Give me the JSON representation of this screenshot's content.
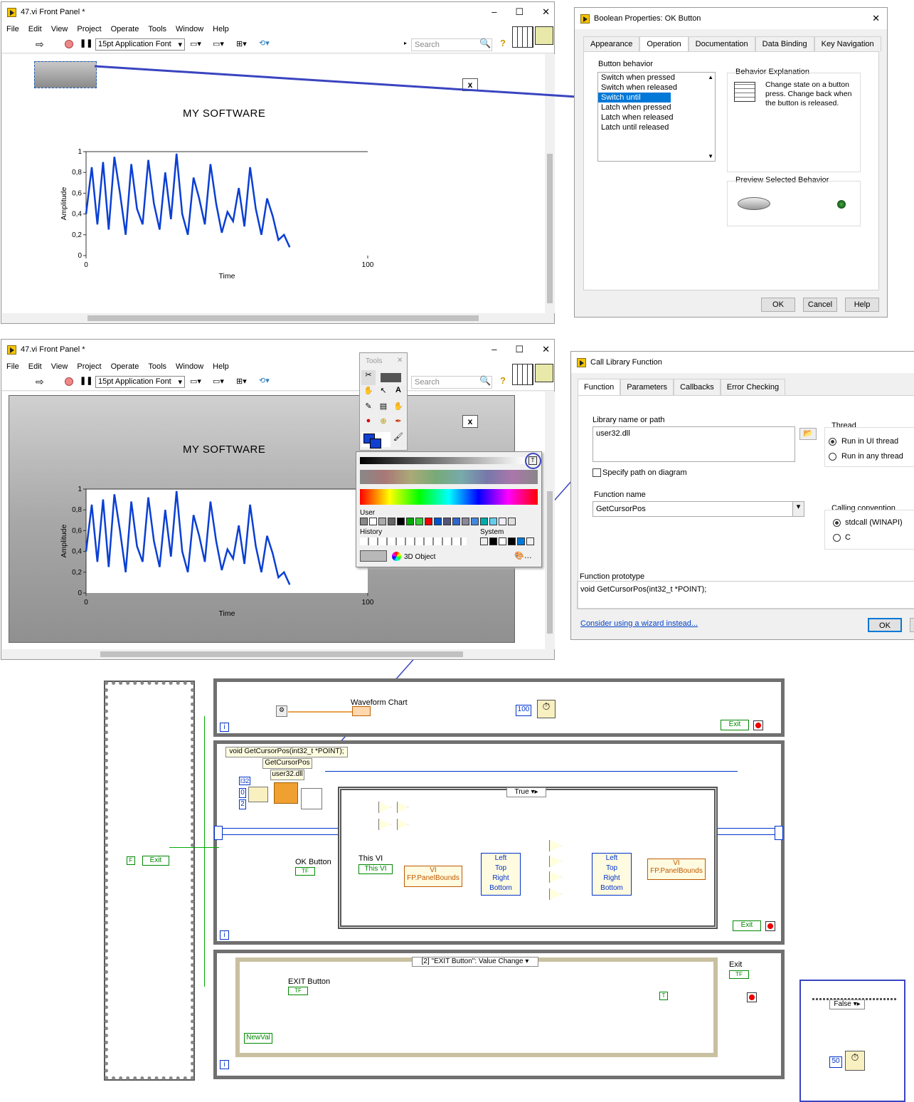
{
  "fp1": {
    "title": "47.vi Front Panel *",
    "menu": [
      "File",
      "Edit",
      "View",
      "Project",
      "Operate",
      "Tools",
      "Window",
      "Help"
    ],
    "font": "15pt Application Font",
    "search": "Search",
    "heading": "MY SOFTWARE",
    "x_label": "x"
  },
  "fp2": {
    "title": "47.vi Front Panel *",
    "menu": [
      "File",
      "Edit",
      "View",
      "Project",
      "Operate",
      "Tools",
      "Window",
      "Help"
    ],
    "font": "15pt Application Font",
    "search": "Search",
    "heading": "MY SOFTWARE",
    "x_label": "x"
  },
  "chart_data": {
    "type": "line",
    "x": [
      0,
      2,
      4,
      6,
      8,
      10,
      12,
      14,
      16,
      18,
      20,
      22,
      24,
      26,
      28,
      30,
      32,
      34,
      36,
      38,
      40,
      42,
      44,
      46,
      48,
      50,
      52,
      54,
      56,
      58,
      60,
      62,
      64,
      66,
      68,
      70,
      72
    ],
    "y": [
      0.4,
      0.85,
      0.3,
      0.9,
      0.25,
      0.95,
      0.6,
      0.2,
      0.88,
      0.45,
      0.3,
      0.92,
      0.5,
      0.25,
      0.8,
      0.35,
      0.98,
      0.4,
      0.2,
      0.75,
      0.55,
      0.3,
      0.88,
      0.5,
      0.22,
      0.42,
      0.33,
      0.65,
      0.28,
      0.85,
      0.45,
      0.2,
      0.55,
      0.38,
      0.15,
      0.2,
      0.08
    ],
    "xlabel": "Time",
    "ylabel": "Amplitude",
    "xlim": [
      0,
      100
    ],
    "ylim": [
      0,
      1
    ],
    "yticks": [
      "1",
      "0,8",
      "0,6",
      "0,4",
      "0,2",
      "0"
    ],
    "xticks": [
      "0",
      "100"
    ],
    "color": "#0a3fd4"
  },
  "bool_dlg": {
    "title": "Boolean Properties: OK Button",
    "tabs": [
      "Appearance",
      "Operation",
      "Documentation",
      "Data Binding",
      "Key Navigation"
    ],
    "behavior_label": "Button behavior",
    "behaviors": [
      "Switch when pressed",
      "Switch when released",
      "Switch until released",
      "Latch when pressed",
      "Latch when released",
      "Latch until released"
    ],
    "selected": 2,
    "explanation_label": "Behavior Explanation",
    "explanation": "Change state on a button press.  Change back when the button is released.",
    "preview_label": "Preview Selected Behavior",
    "ok": "OK",
    "cancel": "Cancel",
    "help": "Help"
  },
  "tools": {
    "title": "Tools",
    "user": "User",
    "history": "History",
    "system": "System",
    "obj3d": "3D Object"
  },
  "clf_dlg": {
    "title": "Call Library Function",
    "tabs": [
      "Function",
      "Parameters",
      "Callbacks",
      "Error Checking"
    ],
    "lib_label": "Library name or path",
    "lib_value": "user32.dll",
    "specify": "Specify path on diagram",
    "fn_label": "Function name",
    "fn_value": "GetCursorPos",
    "thread_label": "Thread",
    "thread_opts": [
      "Run in UI thread",
      "Run in any thread"
    ],
    "cc_label": "Calling convention",
    "cc_opts": [
      "stdcall (WINAPI)",
      "C"
    ],
    "proto_label": "Function prototype",
    "proto_value": "void  GetCursorPos(int32_t *POINT);",
    "wizard": "Consider using a wizard instead...",
    "ok": "OK"
  },
  "bd": {
    "waveform_chart": "Waveform Chart",
    "wait100": "100",
    "exit": "Exit",
    "proto": "void  GetCursorPos(int32_t *POINT);",
    "fn": "GetCursorPos",
    "lib": "user32.dll",
    "i32": "I32",
    "c0": "0",
    "c2": "2",
    "case_true": "True",
    "this_vi": "This VI",
    "this_vi2": "This VI",
    "vi": "VI",
    "pb": "FP.PanelBounds",
    "ok_button": "OK Button",
    "tf": "TF",
    "bounds": [
      "Left",
      "Top",
      "Right",
      "Bottom"
    ],
    "case_false": "False",
    "wait50": "50",
    "event": "[2] \"EXIT Button\": Value Change",
    "exit_button": "EXIT Button",
    "newval": "NewVal",
    "exit2": "Exit",
    "f": "F",
    "t": "T",
    "i": "i"
  }
}
